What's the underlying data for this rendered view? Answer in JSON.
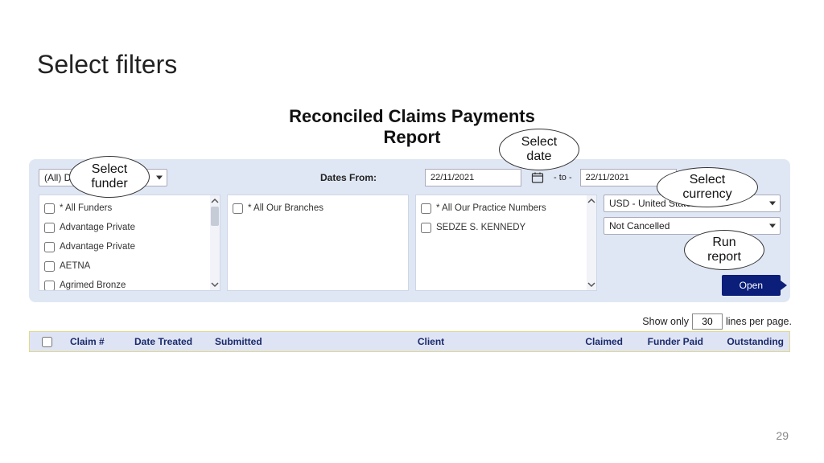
{
  "slide": {
    "title": "Select filters",
    "page_number": "29"
  },
  "report": {
    "title_line1": "Reconciled Claims Payments",
    "title_line2": "Report"
  },
  "filters": {
    "department_select": "(All) D",
    "dates_from_label": "Dates From:",
    "date_from": "22/11/2021",
    "to_label": "- to -",
    "date_to": "22/11/2021",
    "funders": [
      "* All Funders",
      "Advantage Private",
      "Advantage Private",
      "AETNA",
      "Agrimed Bronze"
    ],
    "branches": [
      "* All Our Branches"
    ],
    "practice_numbers": [
      "* All Our Practice Numbers",
      "SEDZE S. KENNEDY"
    ],
    "currency": "USD - United States Dollar",
    "status": "Not Cancelled",
    "open_button": "Open"
  },
  "pager": {
    "prefix": "Show only",
    "value": "30",
    "suffix": "lines per page."
  },
  "table": {
    "headers": {
      "claim": "Claim #",
      "date_treated": "Date Treated",
      "submitted": "Submitted",
      "client": "Client",
      "claimed": "Claimed",
      "funder_paid": "Funder Paid",
      "outstanding": "Outstanding"
    }
  },
  "callouts": {
    "funder": "Select\nfunder",
    "date": "Select\ndate",
    "currency": "Select\ncurrency",
    "run": "Run\nreport"
  }
}
